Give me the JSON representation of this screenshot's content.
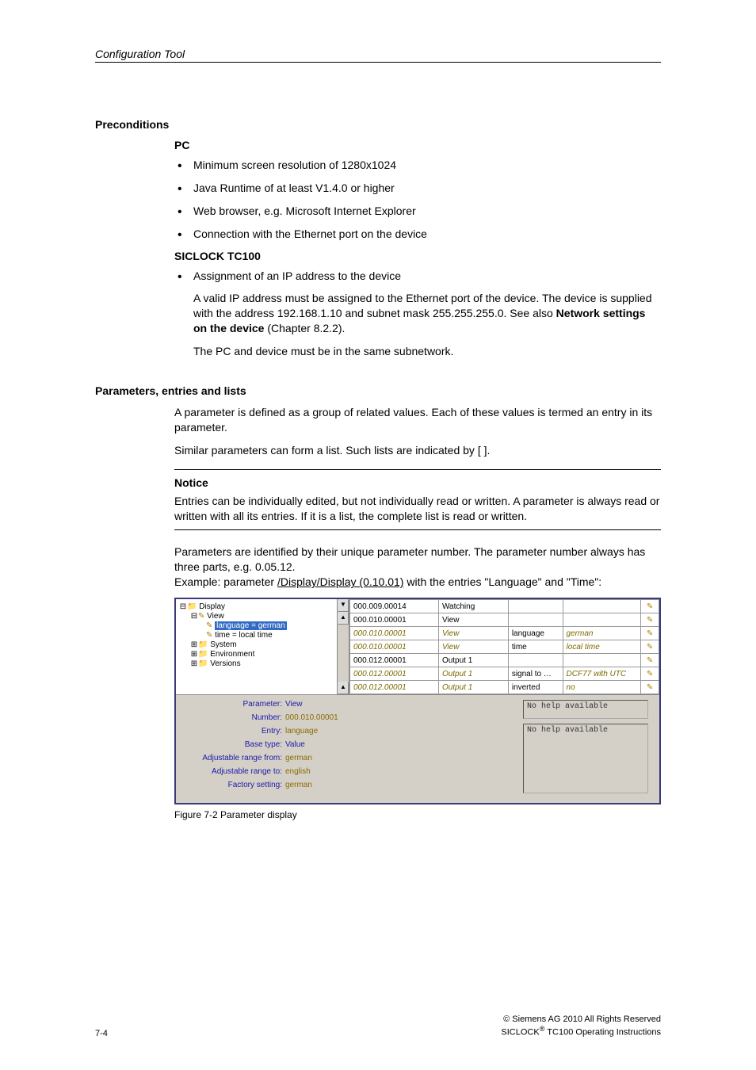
{
  "header": {
    "section": "Configuration Tool"
  },
  "s1": {
    "title": "Preconditions",
    "sub_pc": "PC",
    "pc_bullets": [
      "Minimum screen resolution of 1280x1024",
      "Java Runtime of at least V1.4.0 or higher",
      "Web browser, e.g. Microsoft Internet Explorer",
      "Connection with the Ethernet port on the device"
    ],
    "sub_tc": "SICLOCK TC100",
    "tc_bullet": "Assignment of an IP address to the device",
    "tc_para1a": "A valid IP address must be assigned to the Ethernet port of the device. The device is supplied with the address 192.168.1.10 and subnet mask 255.255.255.0. See also ",
    "tc_para1b_bold": "Network settings on the device",
    "tc_para1c": " (Chapter 8.2.2).",
    "tc_para2": "The PC and device must be in the same subnetwork."
  },
  "s2": {
    "title": "Parameters, entries and lists",
    "p1": "A parameter is defined as a group of related values. Each of these values is termed an entry in its parameter.",
    "p2": "Similar parameters can form a list. Such lists are indicated by [ ].",
    "notice_head": "Notice",
    "notice_body": "Entries can be individually edited, but not individually read or written. A parameter is always read or written with all its entries. If it is a list, the complete list is read or written.",
    "p3_line1": "Parameters are identified by their unique parameter number. The parameter number always has three parts, e.g. 0.05.12.",
    "p3_line2a": "Example: parameter ",
    "p3_line2b_u": "/Display/Display (0.10.01)",
    "p3_line2c": " with the entries \"Language\" and \"Time\":"
  },
  "tree": {
    "n0": "Display",
    "n1": "View",
    "n2": "language = german",
    "n3": "time = local time",
    "n4": "System",
    "n5": "Environment",
    "n6": "Versions"
  },
  "rows": [
    {
      "num": "000.009.00014",
      "name": "Watching",
      "entry": "",
      "val": "",
      "ital": false
    },
    {
      "num": "000.010.00001",
      "name": "View",
      "entry": "",
      "val": "",
      "ital": false
    },
    {
      "num": "000.010.00001",
      "name": "View",
      "entry": "language",
      "val": "german",
      "ital": true
    },
    {
      "num": "000.010.00001",
      "name": "View",
      "entry": "time",
      "val": "local time",
      "ital": true
    },
    {
      "num": "000.012.00001",
      "name": "Output 1",
      "entry": "",
      "val": "",
      "ital": false
    },
    {
      "num": "000.012.00001",
      "name": "Output 1",
      "entry": "signal to …",
      "val": "DCF77 with UTC",
      "ital": true
    },
    {
      "num": "000.012.00001",
      "name": "Output 1",
      "entry": "inverted",
      "val": "no",
      "ital": true
    }
  ],
  "detail": {
    "l_param": "Parameter:",
    "v_param": "View",
    "l_num": "Number:",
    "v_num": "000.010.00001",
    "l_entry": "Entry:",
    "v_entry": "language",
    "l_base": "Base type:",
    "v_base": "Value",
    "l_from": "Adjustable range from:",
    "v_from": "german",
    "l_to": "Adjustable range to:",
    "v_to": "english",
    "l_fact": "Factory setting:",
    "v_fact": "german",
    "help": "No help available"
  },
  "fig_caption": "Figure 7-2 Parameter display",
  "footer": {
    "page": "7-4",
    "copyright": "© Siemens AG 2010 All Rights Reserved",
    "product_a": "SICLOCK",
    "product_b": " TC100 Operating Instructions"
  }
}
